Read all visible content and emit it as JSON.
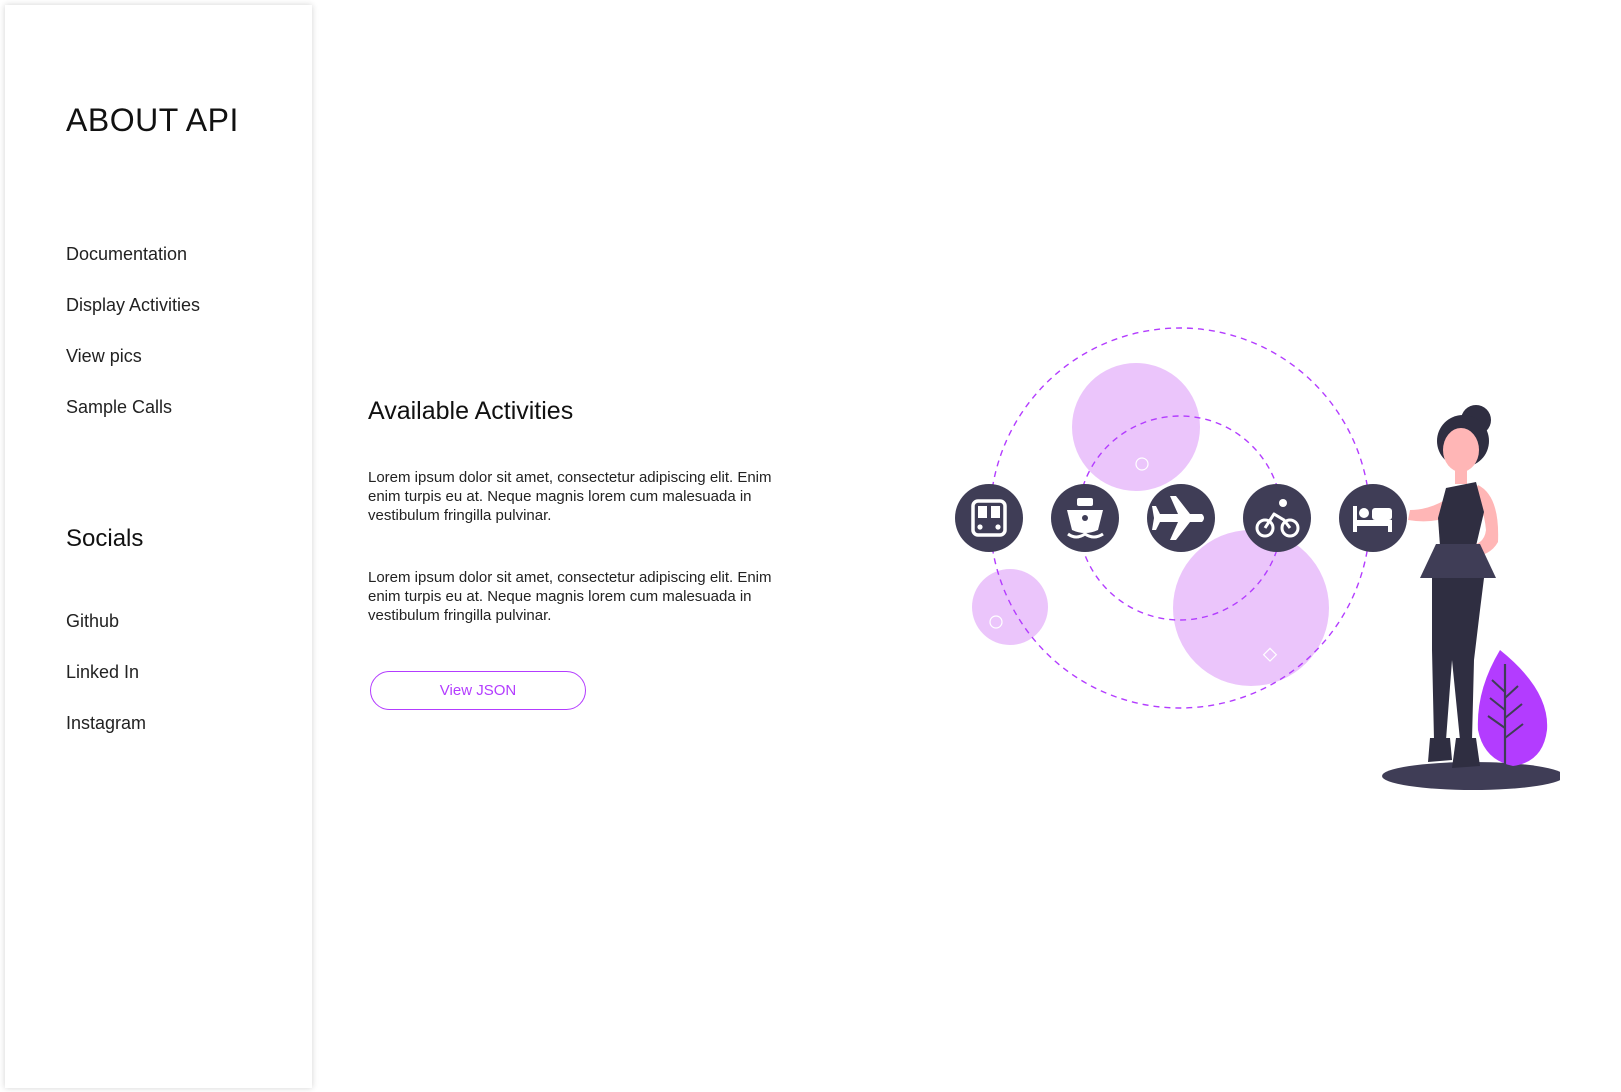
{
  "sidebar": {
    "brand": "ABOUT API",
    "nav_items": [
      {
        "label": "Documentation"
      },
      {
        "label": "Display Activities"
      },
      {
        "label": "View pics"
      },
      {
        "label": "Sample Calls"
      }
    ],
    "socials_title": "Socials",
    "social_items": [
      {
        "label": "Github"
      },
      {
        "label": "Linked In"
      },
      {
        "label": "Instagram"
      }
    ]
  },
  "main": {
    "title": "Available Activities",
    "paragraphs": [
      "Lorem ipsum dolor sit amet, consectetur adipiscing elit. Enim enim turpis eu at. Neque magnis lorem cum malesuada in vestibulum fringilla pulvinar.",
      "Lorem ipsum dolor sit amet, consectetur adipiscing elit. Enim enim turpis eu at. Neque magnis lorem cum malesuada in vestibulum fringilla pulvinar."
    ],
    "button_label": "View JSON"
  },
  "illustration": {
    "activity_icons": [
      "bus-icon",
      "ship-icon",
      "airplane-icon",
      "bicycle-icon",
      "bed-icon"
    ],
    "colors": {
      "accent": "#b33cff",
      "bubble": "#ebc5fb",
      "icon_circle": "#3f3d56",
      "skin": "#ffb6b6",
      "plant": "#b33cff"
    }
  }
}
